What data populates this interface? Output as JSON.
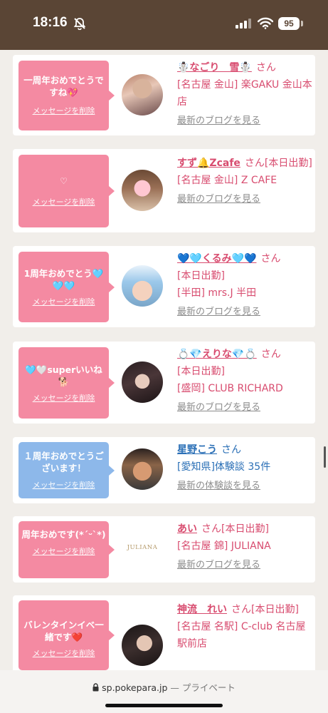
{
  "status": {
    "time": "18:16",
    "battery": "95"
  },
  "browser": {
    "url": "sp.pokepara.jp",
    "separator": "—",
    "mode": "プライベート"
  },
  "cards": [
    {
      "message": "一周年おめでとうですね💖",
      "delete": "メッセージを削除",
      "name": "☃️なごり　雪☃️",
      "san": "さん",
      "lines": [
        "[名古屋 金山] 楽GAKU 金山本店"
      ],
      "link": "最新のブログを見る"
    },
    {
      "message": "♡",
      "delete": "メッセージを削除",
      "name": "すず🔔Zcafe",
      "san": "さん[本日出勤]",
      "lines": [
        "[名古屋 金山] Z CAFE"
      ],
      "link": "最新のブログを見る"
    },
    {
      "message": "1周年おめでとう🩵🩵🩵",
      "delete": "メッセージを削除",
      "name": "💙🩵くるみ🩵💙",
      "san": "さん",
      "lines": [
        "[本日出勤]",
        "[半田] mrs.J 半田"
      ],
      "link": "最新のブログを見る"
    },
    {
      "message": "🩵🤍superいいね🐕",
      "delete": "メッセージを削除",
      "name": "💍💎えりな💎💍",
      "san": "さん",
      "lines": [
        "[本日出勤]",
        "[盛岡] CLUB RICHARD"
      ],
      "link": "最新のブログを見る"
    },
    {
      "message": "１周年おめでとうございます！",
      "delete": "メッセージを削除",
      "name": "星野こう",
      "san": "さん",
      "lines": [
        "[愛知県]体験談 35件"
      ],
      "link": "最新の体験談を見る"
    },
    {
      "message": "周年おめです(*´ᵕ`*)",
      "delete": "メッセージを削除",
      "name": "あい",
      "san": "さん[本日出勤]",
      "lines": [
        "[名古屋 錦] JULIANA"
      ],
      "link": "最新のブログを見る",
      "logo": "JULIANA"
    },
    {
      "message": "バレンタインイベ一緒です❤️",
      "delete": "メッセージを削除",
      "name": "神流　れい",
      "san": "さん[本日出勤]",
      "lines": [
        "[名古屋 名駅] C-club 名古屋駅前店"
      ],
      "link": "最新のブログを見る"
    }
  ]
}
